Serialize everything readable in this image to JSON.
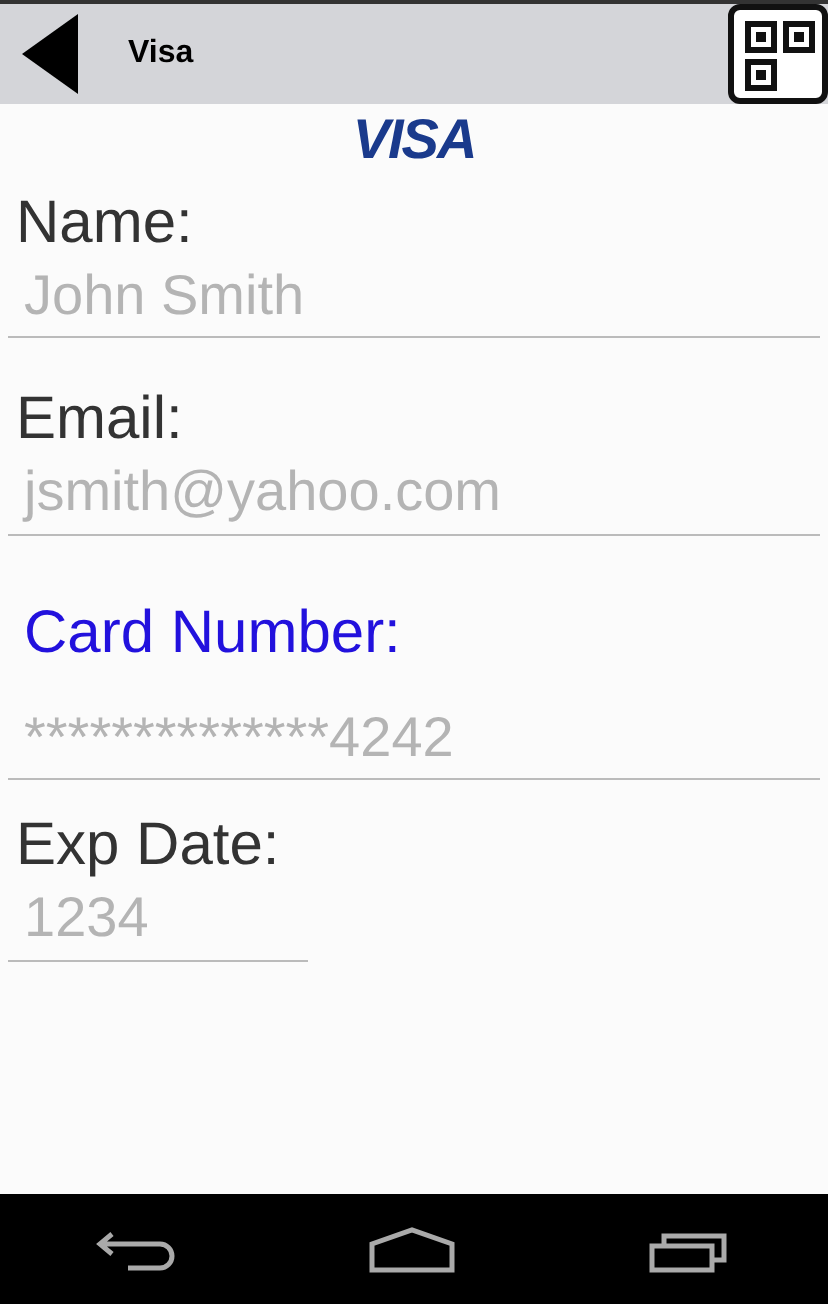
{
  "title": "Visa",
  "logo": "VISA",
  "fields": [
    {
      "label": "Name:",
      "placeholder": "John Smith",
      "focused": false,
      "kind": "wide"
    },
    {
      "label": "Email:",
      "placeholder": "jsmith@yahoo.com",
      "focused": false,
      "kind": "wide"
    },
    {
      "label": "Card Number:",
      "placeholder": "**************4242",
      "focused": true,
      "kind": "wide"
    },
    {
      "label": "Exp Date:",
      "placeholder": "1234",
      "focused": false,
      "kind": "short"
    }
  ]
}
